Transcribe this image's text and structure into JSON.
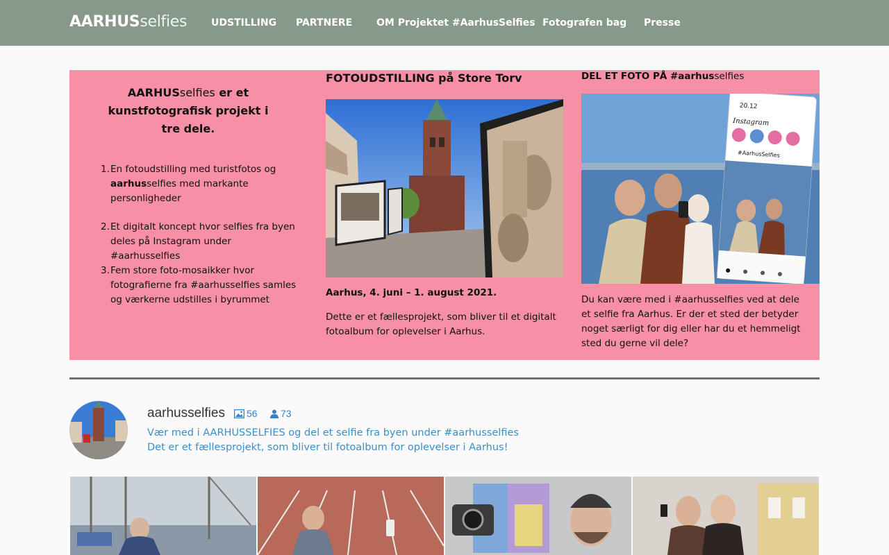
{
  "header": {
    "logo_bold": "AARHUS",
    "logo_light": "selfies",
    "nav": [
      "UDSTILLING",
      "PARTNERE",
      "OM Projektet #AarhusSelfies",
      "Fotografen bag",
      "Presse"
    ]
  },
  "intro": {
    "title_brand_bold": "AARHUS",
    "title_brand_light": "selfies",
    "title_rest": " er et kunstfotografisk projekt i tre dele.",
    "items": [
      {
        "num": "1.",
        "a": "En fotoudstilling med turistfotos og ",
        "b": "aarhus",
        "c": "selfies med markante personligheder"
      },
      {
        "num": "2.",
        "a": "Et digitalt koncept hvor selfies fra byen deles på Instagram under #aarhusselfies",
        "b": "",
        "c": ""
      },
      {
        "num": "3.",
        "a": "Fem store foto-mosaikker hvor fotografierne fra #aarhusselfies samles og værkerne udstilles i byrummet",
        "b": "",
        "c": ""
      }
    ]
  },
  "exhibition": {
    "title": "FOTOUDSTILLING på Store Torv",
    "date": "Aarhus, 4. juni – 1. august 2021.",
    "text": "Dette er et fællesprojekt, som bliver til et digitalt fotoalbum for oplevelser i Aarhus."
  },
  "share": {
    "title_bold": "DEL ET FOTO PÅ #aarhus",
    "title_light": "selfies",
    "text": "Du kan være med i #aarhusselfies ved at dele et selfie fra Aarhus. Er der et sted der betyder noget særligt for dig eller har du et hemmeligt sted du gerne vil dele?",
    "phone_time": "20.12",
    "phone_app": "Instagram",
    "phone_profile": "#AarhusSelfies"
  },
  "instagram": {
    "username": "aarhusselfies",
    "posts": "56",
    "followers": "73",
    "bio_line1": "Vær med i AARHUSSELFIES og del et selfie fra byen under #aarhusselfies",
    "bio_line2": "Det er et fællesprojekt, som bliver til fotoalbum for oplevelser i Aarhus!"
  },
  "colors": {
    "header_bg": "#879988",
    "pink": "#f78fa7",
    "link_blue": "#3a8fc9"
  }
}
